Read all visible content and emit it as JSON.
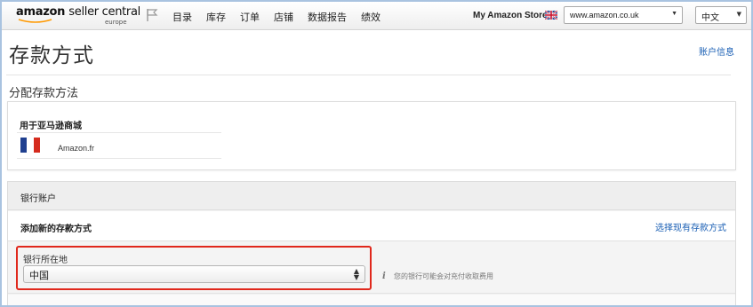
{
  "header": {
    "logo_main": "amazon",
    "logo_sub": "seller central",
    "logo_region": "europe",
    "nav": [
      "目录",
      "库存",
      "订单",
      "店铺",
      "数据报告",
      "绩效"
    ],
    "store_label": "My Amazon Store",
    "site_select": "www.amazon.co.uk",
    "lang_select": "中文"
  },
  "page": {
    "title": "存款方式",
    "account_link": "账户信息",
    "section_title": "分配存款方法"
  },
  "marketplace": {
    "heading": "用于亚马逊商城",
    "name": "Amazon.fr"
  },
  "bank": {
    "header": "银行账户",
    "add_label": "添加新的存款方式",
    "choose_link": "选择现有存款方式",
    "country_label": "银行所在地",
    "country_value": "中国",
    "info_icon": "i",
    "info_text": "您的银行可能会对充付收取费用"
  },
  "colors": {
    "link": "#1a5fb4",
    "highlight_border": "#e0281c",
    "frame_border": "#a9c3e0"
  },
  "icons": [
    "flag-icon",
    "uk-flag-icon",
    "chevron-down-icon",
    "updown-icon",
    "info-icon"
  ]
}
